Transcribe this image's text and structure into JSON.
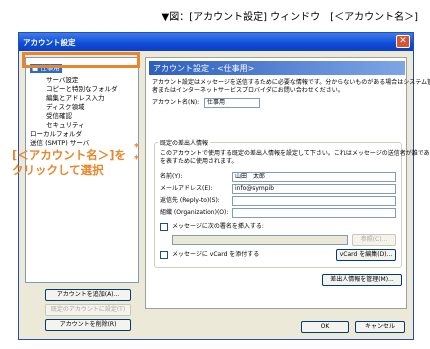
{
  "caption": "▼図：[アカウント設定] ウィンドウ　[＜アカウント名＞]",
  "window": {
    "title": "アカウント設定",
    "close": "✕"
  },
  "tree": {
    "items": [
      {
        "label": "■ 仕事用",
        "selected": true
      },
      {
        "label": "サーバ設定"
      },
      {
        "label": "コピーと特別なフォルダ"
      },
      {
        "label": "編集とアドレス入力"
      },
      {
        "label": "ディスク領域"
      },
      {
        "label": "受信確認"
      },
      {
        "label": "セキュリティ"
      },
      {
        "label": "ローカルフォルダ"
      },
      {
        "label": "送信 (SMTP) サーバ"
      }
    ]
  },
  "annotation": {
    "star": "*",
    "line1": "[＜アカウント名＞]を",
    "line2": "クリックして選択"
  },
  "left_buttons": {
    "add": "アカウントを追加(A)...",
    "default": "既定のアカウントに設定(T)",
    "delete": "アカウントを削除(R)"
  },
  "panel": {
    "heading": "アカウント設定 - <仕事用>",
    "desc1": "アカウント設定はメッセージを送信するために必要な情報です。分からないものがある場合はシステム管理",
    "desc2": "者またはインターネットサービスプロバイダにお問い合わせください。",
    "account_name_label": "アカウント名(N):",
    "account_name_value": "仕事用",
    "identity_legend": "既定の差出人情報",
    "identity_desc1": "このアカウントで使用する既定の差出人情報を設定して下さい。これはメッセージの送信者が誰であるか",
    "identity_desc2": "を表すために使用されます。",
    "name_label": "名前(Y):",
    "name_value": "山田　太郎",
    "email_label": "メールアドレス(E):",
    "email_value": "info@sympib",
    "replyto_label": "返信先 (Reply-to)(S):",
    "replyto_value": "",
    "org_label": "組織 (Organization)(O):",
    "org_value": "",
    "signature_label": "メッセージに次の署名を挿入する:",
    "browse_label": "参照(C)...",
    "vcard_label": "メッセージに vCard を添付する",
    "vcard_edit": "vCard を編集(D)...",
    "manage_identities": "差出人情報を管理(M)..."
  },
  "footer": {
    "ok": "OK",
    "cancel": "キャンセル"
  }
}
